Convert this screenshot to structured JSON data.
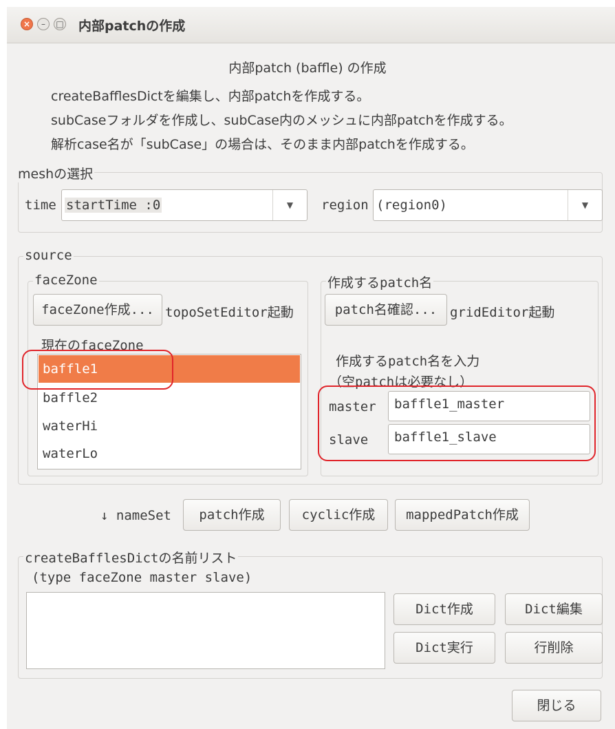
{
  "window": {
    "title": "内部patchの作成"
  },
  "header": {
    "title": "内部patch (baffle) の作成",
    "lines": [
      "createBafflesDictを編集し、内部patchを作成する。",
      "subCaseフォルダを作成し、subCase内のメッシュに内部patchを作成する。",
      "解析case名が「subCase」の場合は、そのまま内部patchを作成する。"
    ]
  },
  "mesh": {
    "label": "meshの選択",
    "time_label": "time",
    "time_value": "startTime :0",
    "region_label": "region",
    "region_value": "(region0)"
  },
  "source": {
    "label": "source",
    "facezone": {
      "label": "faceZone",
      "create_button": "faceZone作成...",
      "editor_label": "topoSetEditor起動",
      "current_label": "現在のfaceZone",
      "items": [
        "baffle1",
        "baffle2",
        "waterHi",
        "waterLo"
      ],
      "selected": "baffle1"
    },
    "patch": {
      "label": "作成するpatch名",
      "check_button": "patch名確認...",
      "editor_label": "gridEditor起動",
      "instruction": "作成するpatch名を入力",
      "note": "（空patchは必要なし）",
      "master_label": "master",
      "master_value": "baffle1_master",
      "slave_label": "slave",
      "slave_value": "baffle1_slave"
    }
  },
  "actions": {
    "nameset_label": "↓ nameSet",
    "patch_button": "patch作成",
    "cyclic_button": "cyclic作成",
    "mapped_button": "mappedPatch作成"
  },
  "dict": {
    "label": "createBafflesDictの名前リスト",
    "columns": "(type  faceZone  master  slave)",
    "items": [],
    "create_button": "Dict作成",
    "edit_button": "Dict編集",
    "run_button": "Dict実行",
    "delete_button": "行削除"
  },
  "footer": {
    "close_button": "閉じる"
  },
  "colors": {
    "selection": "#f07c48",
    "highlight_box": "#e0242a",
    "window_bg": "#f2f1f0"
  }
}
